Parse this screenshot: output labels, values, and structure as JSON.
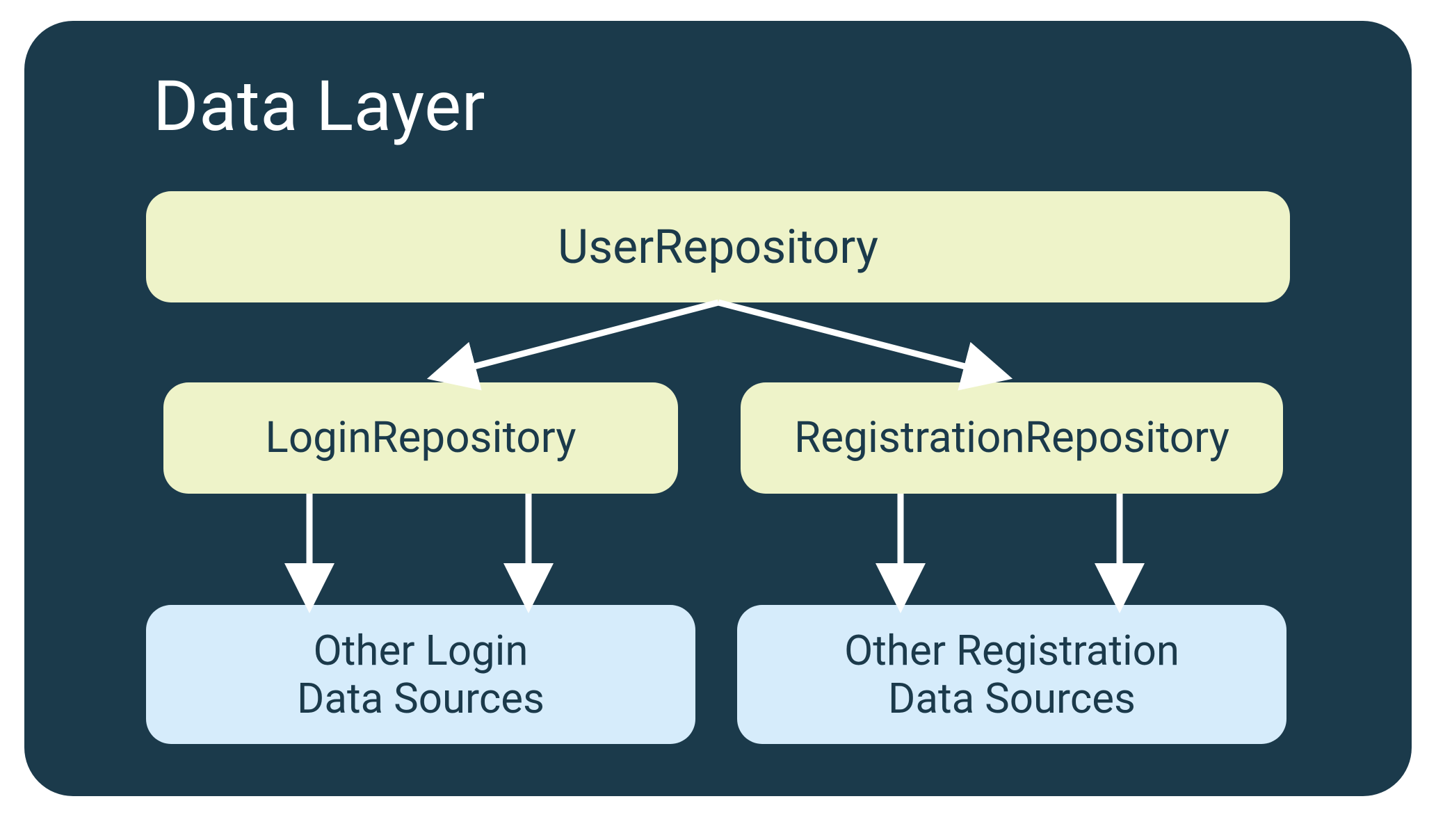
{
  "title": "Data Layer",
  "colors": {
    "panel_bg": "#1b3a4b",
    "node_green": "#eef3c9",
    "node_blue": "#d6ecfb",
    "text_dark": "#1b3a4b",
    "arrow": "#ffffff"
  },
  "nodes": {
    "user_repository": {
      "label": "UserRepository",
      "type": "repository"
    },
    "login_repository": {
      "label": "LoginRepository",
      "type": "repository"
    },
    "registration_repository": {
      "label": "RegistrationRepository",
      "type": "repository"
    },
    "login_data_sources": {
      "line1": "Other Login",
      "line2": "Data Sources",
      "type": "data-source"
    },
    "registration_data_sources": {
      "line1": "Other Registration",
      "line2": "Data Sources",
      "type": "data-source"
    }
  },
  "edges": [
    {
      "from": "user_repository",
      "to": "login_repository"
    },
    {
      "from": "user_repository",
      "to": "registration_repository"
    },
    {
      "from": "login_repository",
      "to": "login_data_sources"
    },
    {
      "from": "registration_repository",
      "to": "registration_data_sources"
    }
  ]
}
